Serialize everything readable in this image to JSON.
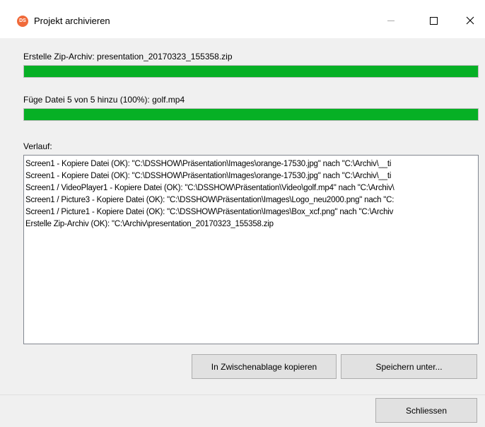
{
  "window": {
    "title": "Projekt archivieren",
    "app_icon": "DS",
    "controls": {
      "minimize": "minimize-icon",
      "maximize": "maximize-icon",
      "close": "close-icon"
    }
  },
  "archive": {
    "label": "Erstelle Zip-Archiv: presentation_20170323_155358.zip",
    "progress_percent": 100
  },
  "file": {
    "label": "Füge Datei 5 von 5 hinzu (100%): golf.mp4",
    "progress_percent": 100
  },
  "history": {
    "label": "Verlauf:",
    "lines": [
      "Screen1 - Kopiere Datei (OK): \"C:\\DSSHOW\\Präsentation\\Images\\orange-17530.jpg\" nach \"C:\\Archiv\\__ti",
      "Screen1 - Kopiere Datei (OK): \"C:\\DSSHOW\\Präsentation\\Images\\orange-17530.jpg\" nach \"C:\\Archiv\\__ti",
      "Screen1 / VideoPlayer1 - Kopiere Datei (OK): \"C:\\DSSHOW\\Präsentation\\Video\\golf.mp4\" nach \"C:\\Archiv\\",
      "Screen1 / Picture3 - Kopiere Datei (OK): \"C:\\DSSHOW\\Präsentation\\Images\\Logo_neu2000.png\" nach \"C:",
      "Screen1 / Picture1 - Kopiere Datei (OK): \"C:\\DSSHOW\\Präsentation\\Images\\Box_xcf.png\" nach \"C:\\Archiv",
      "Erstelle Zip-Archiv (OK): \"C:\\Archiv\\presentation_20170323_155358.zip"
    ]
  },
  "buttons": {
    "copy": "In Zwischenablage kopieren",
    "save": "Speichern unter...",
    "close": "Schliessen"
  },
  "colors": {
    "progress": "#06b025"
  }
}
